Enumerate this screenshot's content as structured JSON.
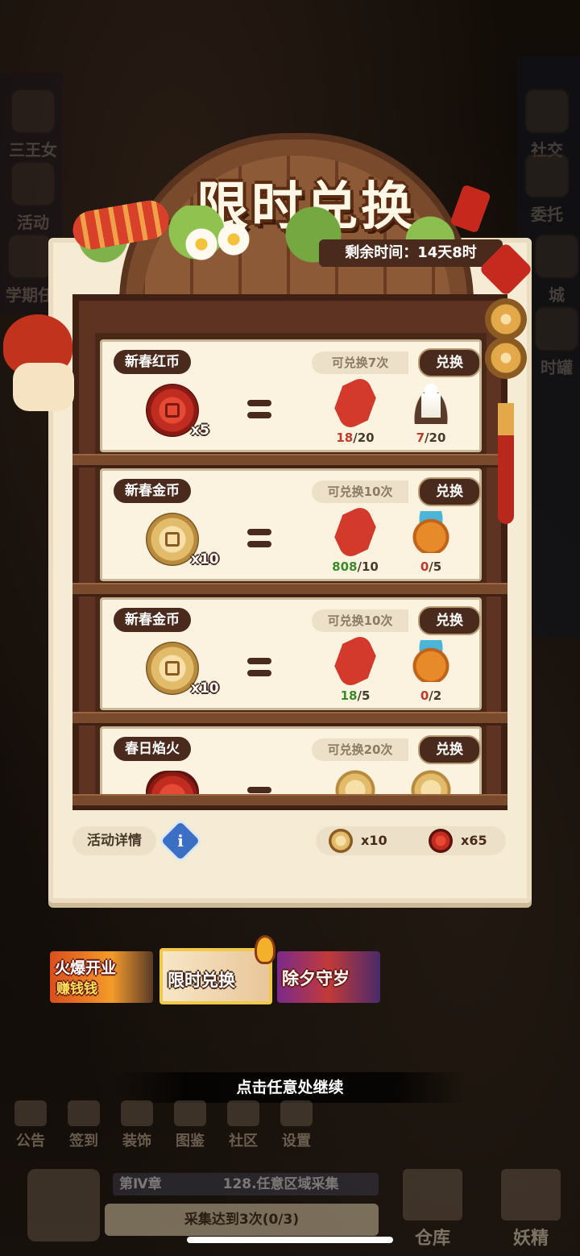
{
  "side_menu_left": [
    "三王女",
    "活动",
    "学期任"
  ],
  "side_menu_right": [
    "社交",
    "委托",
    "城",
    "时罐"
  ],
  "panel": {
    "title": "限时兑换",
    "time_remaining": "剩余时间：14天8时"
  },
  "exchange_rows": [
    {
      "title": "新春红币",
      "limit": "可兑换7次",
      "button": "兑换",
      "cost": {
        "coin": "red",
        "qty": "x5"
      },
      "items": [
        {
          "icon": "firecracker-icon",
          "have": "18",
          "need": "/20",
          "enough": false
        },
        {
          "icon": "candle-icon",
          "have": "7",
          "need": "/20",
          "enough": false
        }
      ]
    },
    {
      "title": "新春金币",
      "limit": "可兑换10次",
      "button": "兑换",
      "cost": {
        "coin": "gold",
        "qty": "x10"
      },
      "items": [
        {
          "icon": "firecracker-icon",
          "have": "808",
          "need": "/10",
          "enough": true
        },
        {
          "icon": "lucky-bag-icon",
          "have": "0",
          "need": "/5",
          "enough": false
        }
      ]
    },
    {
      "title": "新春金币",
      "limit": "可兑换10次",
      "button": "兑换",
      "cost": {
        "coin": "gold",
        "qty": "x10"
      },
      "items": [
        {
          "icon": "firecracker-icon",
          "have": "18",
          "need": "/5",
          "enough": true
        },
        {
          "icon": "lucky-bag-icon",
          "have": "0",
          "need": "/2",
          "enough": false
        }
      ]
    },
    {
      "title": "春日焰火",
      "limit": "可兑换20次",
      "button": "兑换",
      "cost": {
        "coin": "red-pot",
        "qty": ""
      },
      "items": [
        {
          "icon": "gold-coin-icon",
          "have": "",
          "need": "",
          "enough": false
        },
        {
          "icon": "gold-coin-icon",
          "have": "",
          "need": "",
          "enough": false
        }
      ]
    }
  ],
  "footer": {
    "details_label": "活动详情",
    "info_glyph": "i",
    "gold_count": "x10",
    "red_count": "x65"
  },
  "tabs": [
    {
      "label": "火爆开业赚钱钱",
      "line1": "火爆开业",
      "line2": "赚钱钱"
    },
    {
      "label": "限时兑换",
      "selected": true
    },
    {
      "label": "除夕守岁"
    }
  ],
  "continue_hint": "点击任意处继续",
  "bottom_nav": [
    "公告",
    "签到",
    "装饰",
    "图鉴",
    "社区",
    "设置"
  ],
  "chapter": {
    "chapter_label": "第Ⅳ章",
    "task_name": "128.任意区域采集",
    "task_progress": "采集达到3次(0/3)"
  },
  "bottom_right": [
    "仓库",
    "妖精"
  ],
  "colors": {
    "panel_bg": "#f6ecd5",
    "wood_dark": "#4a2a1c",
    "not_enough": "#c0392b",
    "enough": "#3a8a2a"
  }
}
